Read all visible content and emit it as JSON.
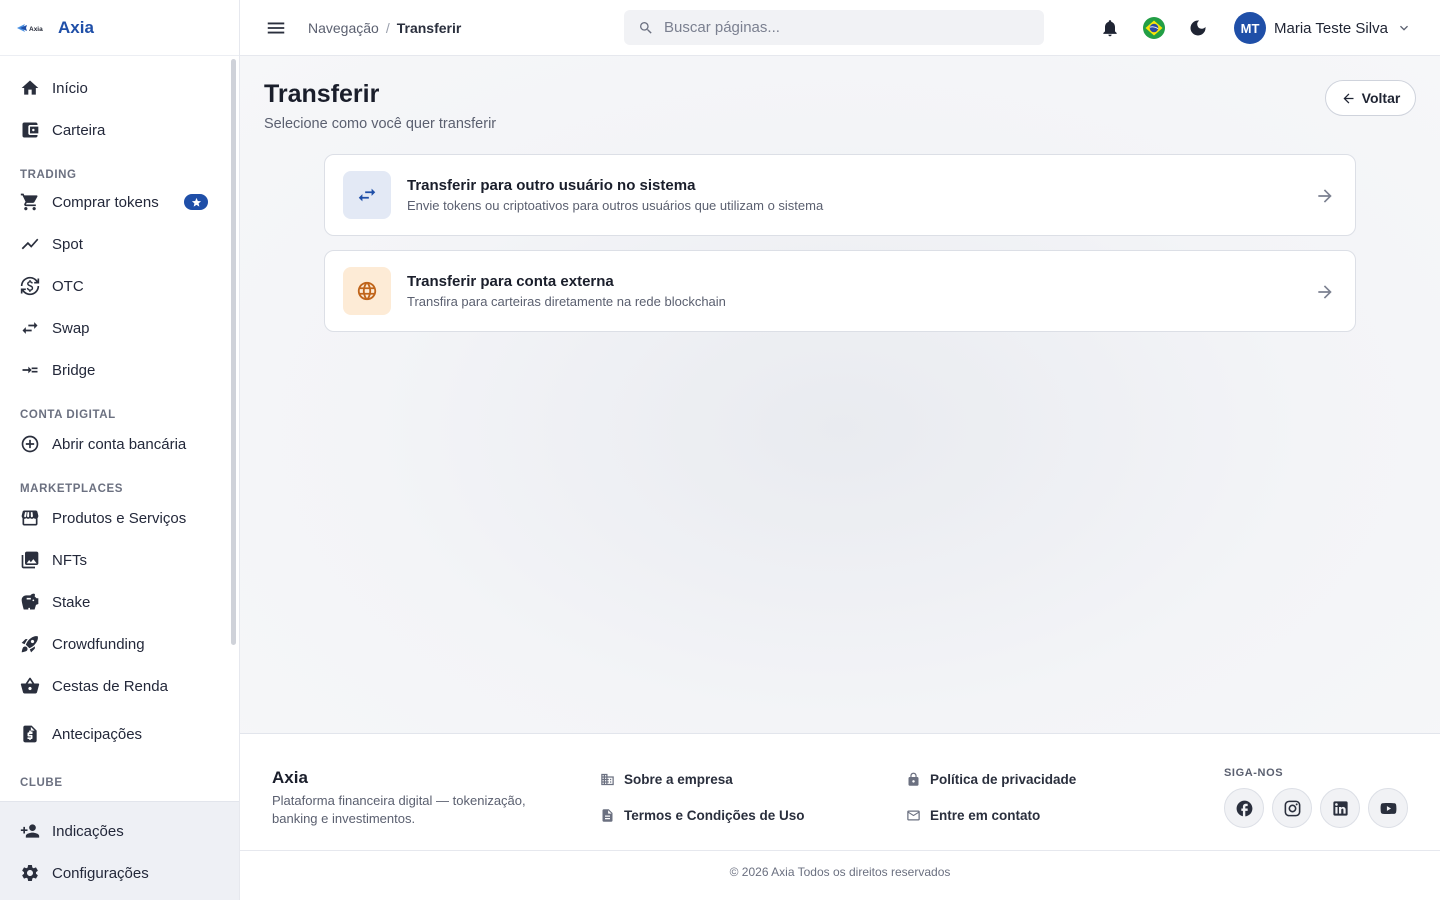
{
  "brand": {
    "logo_text": "Axia",
    "name": "Axia"
  },
  "sidebar": {
    "items_top": [
      {
        "label": "Início",
        "icon": "home-icon"
      },
      {
        "label": "Carteira",
        "icon": "wallet-icon"
      }
    ],
    "sections": [
      {
        "title": "TRADING",
        "items": [
          {
            "label": "Comprar tokens",
            "icon": "cart-icon",
            "badge": "star-badge"
          },
          {
            "label": "Spot",
            "icon": "trending-icon"
          },
          {
            "label": "OTC",
            "icon": "currency-exchange-icon"
          },
          {
            "label": "Swap",
            "icon": "swap-icon"
          },
          {
            "label": "Bridge",
            "icon": "bridge-icon"
          }
        ]
      },
      {
        "title": "CONTA DIGITAL",
        "items": [
          {
            "label": "Abrir conta bancária",
            "icon": "add-circle-icon"
          }
        ]
      },
      {
        "title": "MARKETPLACES",
        "items": [
          {
            "label": "Produtos e Serviços",
            "icon": "store-icon"
          },
          {
            "label": "NFTs",
            "icon": "image-collection-icon"
          },
          {
            "label": "Stake",
            "icon": "piggy-bank-icon"
          },
          {
            "label": "Crowdfunding",
            "icon": "rocket-icon"
          },
          {
            "label": "Cestas de Renda",
            "icon": "basket-icon"
          },
          {
            "label": "Antecipações",
            "icon": "invoice-icon"
          }
        ]
      },
      {
        "title": "CLUBE",
        "items": []
      }
    ],
    "bottom_items": [
      {
        "label": "Indicações",
        "icon": "person-add-icon"
      },
      {
        "label": "Configurações",
        "icon": "gear-icon"
      }
    ]
  },
  "header": {
    "breadcrumb": {
      "root": "Navegação",
      "separator": "/",
      "current": "Transferir"
    },
    "search": {
      "placeholder": "Buscar páginas..."
    },
    "user": {
      "initials": "MT",
      "name": "Maria Teste Silva"
    }
  },
  "main": {
    "title": "Transferir",
    "subtitle": "Selecione como você quer transferir",
    "back_label": "Voltar",
    "options": [
      {
        "title": "Transferir para outro usuário no sistema",
        "description": "Envie tokens ou criptoativos para outros usuários que utilizam o sistema",
        "icon": "swap-arrows-icon",
        "icon_bg": "#e3e9f5",
        "icon_color": "#1f4fa8"
      },
      {
        "title": "Transferir para conta externa",
        "description": "Transfira para carteiras diretamente na rede blockchain",
        "icon": "globe-icon",
        "icon_bg": "#fdebd6",
        "icon_color": "#c0641a"
      }
    ]
  },
  "footer": {
    "brand": "Axia",
    "tagline": "Plataforma financeira digital — tokenização, banking e investimentos.",
    "links": [
      {
        "label": "Sobre a empresa",
        "icon": "building-icon"
      },
      {
        "label": "Política de privacidade",
        "icon": "lock-icon"
      },
      {
        "label": "Termos e Condições de Uso",
        "icon": "document-icon"
      },
      {
        "label": "Entre em contato",
        "icon": "mail-icon"
      }
    ],
    "follow_title": "SIGA-NOS",
    "social": [
      "facebook-icon",
      "instagram-icon",
      "linkedin-icon",
      "youtube-icon"
    ],
    "copyright": "© 2026 Axia Todos os direitos reservados"
  },
  "colors": {
    "accent": "#1f4fa8",
    "background": "#f4f5f8"
  }
}
